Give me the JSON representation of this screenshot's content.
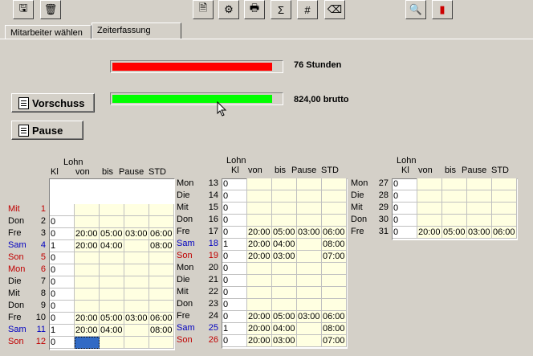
{
  "toolbar": [
    {
      "name": "save-icon",
      "glyph": "🖫"
    },
    {
      "name": "delete-icon",
      "glyph": "🗑"
    },
    {
      "name": "document-icon",
      "glyph": "🗎"
    },
    {
      "name": "calculate-icon",
      "glyph": "⚙"
    },
    {
      "name": "print-icon",
      "glyph": "🖶"
    },
    {
      "name": "sum-icon",
      "glyph": "Σ"
    },
    {
      "name": "number-document-icon",
      "glyph": "#"
    },
    {
      "name": "eraser-icon",
      "glyph": "⌫"
    },
    {
      "name": "search-icon",
      "glyph": "🔍"
    },
    {
      "name": "exit-icon",
      "glyph": "▮"
    }
  ],
  "tabs": {
    "employees": "Mitarbeiter wählen",
    "time": "Zeiterfassung"
  },
  "bars": {
    "hours": {
      "label": "76 Stunden",
      "fraction": 0.95,
      "color": "#ff0000"
    },
    "gross": {
      "label": "824,00 brutto",
      "fraction": 0.95,
      "color": "#00ff00"
    }
  },
  "buttons": {
    "advance": "Vorschuss",
    "pause": "Pause"
  },
  "headers": {
    "lohn": "Lohn",
    "kl": "Kl",
    "von": "von",
    "bis": "bis",
    "pause": "Pause",
    "std": "STD"
  },
  "colors": {
    "weekday": "#000000",
    "saturday": "#0000c0",
    "sunday_holiday": "#c00000"
  },
  "columns": [
    {
      "rows": [
        {
          "day": "Mit",
          "num": "1",
          "color": "red",
          "kl": "",
          "von": "",
          "bis": "",
          "pause": "",
          "std": ""
        },
        {
          "day": "Don",
          "num": "2",
          "color": "",
          "kl": "0",
          "von": "",
          "bis": "",
          "pause": "",
          "std": ""
        },
        {
          "day": "Fre",
          "num": "3",
          "color": "",
          "kl": "0",
          "von": "20:00",
          "bis": "05:00",
          "pause": "03:00",
          "std": "06:00"
        },
        {
          "day": "Sam",
          "num": "4",
          "color": "blue",
          "kl": "1",
          "von": "20:00",
          "bis": "04:00",
          "pause": "",
          "std": "08:00"
        },
        {
          "day": "Son",
          "num": "5",
          "color": "red",
          "kl": "0",
          "von": "",
          "bis": "",
          "pause": "",
          "std": ""
        },
        {
          "day": "Mon",
          "num": "6",
          "color": "red",
          "kl": "0",
          "von": "",
          "bis": "",
          "pause": "",
          "std": ""
        },
        {
          "day": "Die",
          "num": "7",
          "color": "",
          "kl": "0",
          "von": "",
          "bis": "",
          "pause": "",
          "std": ""
        },
        {
          "day": "Mit",
          "num": "8",
          "color": "",
          "kl": "0",
          "von": "",
          "bis": "",
          "pause": "",
          "std": ""
        },
        {
          "day": "Don",
          "num": "9",
          "color": "",
          "kl": "0",
          "von": "",
          "bis": "",
          "pause": "",
          "std": ""
        },
        {
          "day": "Fre",
          "num": "10",
          "color": "",
          "kl": "0",
          "von": "20:00",
          "bis": "05:00",
          "pause": "03:00",
          "std": "06:00"
        },
        {
          "day": "Sam",
          "num": "11",
          "color": "blue",
          "kl": "1",
          "von": "20:00",
          "bis": "04:00",
          "pause": "",
          "std": "08:00"
        },
        {
          "day": "Son",
          "num": "12",
          "color": "red",
          "kl": "0",
          "von": "",
          "bis": "",
          "pause": "",
          "std": "",
          "selected": true
        }
      ]
    },
    {
      "rows": [
        {
          "day": "Mon",
          "num": "13",
          "color": "",
          "kl": "0",
          "von": "",
          "bis": "",
          "pause": "",
          "std": ""
        },
        {
          "day": "Die",
          "num": "14",
          "color": "",
          "kl": "0",
          "von": "",
          "bis": "",
          "pause": "",
          "std": ""
        },
        {
          "day": "Mit",
          "num": "15",
          "color": "",
          "kl": "0",
          "von": "",
          "bis": "",
          "pause": "",
          "std": ""
        },
        {
          "day": "Don",
          "num": "16",
          "color": "",
          "kl": "0",
          "von": "",
          "bis": "",
          "pause": "",
          "std": ""
        },
        {
          "day": "Fre",
          "num": "17",
          "color": "",
          "kl": "0",
          "von": "20:00",
          "bis": "05:00",
          "pause": "03:00",
          "std": "06:00"
        },
        {
          "day": "Sam",
          "num": "18",
          "color": "blue",
          "kl": "1",
          "von": "20:00",
          "bis": "04:00",
          "pause": "",
          "std": "08:00"
        },
        {
          "day": "Son",
          "num": "19",
          "color": "red",
          "kl": "0",
          "von": "20:00",
          "bis": "03:00",
          "pause": "",
          "std": "07:00"
        },
        {
          "day": "Mon",
          "num": "20",
          "color": "",
          "kl": "0",
          "von": "",
          "bis": "",
          "pause": "",
          "std": ""
        },
        {
          "day": "Die",
          "num": "21",
          "color": "",
          "kl": "0",
          "von": "",
          "bis": "",
          "pause": "",
          "std": ""
        },
        {
          "day": "Mit",
          "num": "22",
          "color": "",
          "kl": "0",
          "von": "",
          "bis": "",
          "pause": "",
          "std": ""
        },
        {
          "day": "Don",
          "num": "23",
          "color": "",
          "kl": "0",
          "von": "",
          "bis": "",
          "pause": "",
          "std": ""
        },
        {
          "day": "Fre",
          "num": "24",
          "color": "",
          "kl": "0",
          "von": "20:00",
          "bis": "05:00",
          "pause": "03:00",
          "std": "06:00"
        },
        {
          "day": "Sam",
          "num": "25",
          "color": "blue",
          "kl": "1",
          "von": "20:00",
          "bis": "04:00",
          "pause": "",
          "std": "08:00"
        },
        {
          "day": "Son",
          "num": "26",
          "color": "red",
          "kl": "0",
          "von": "20:00",
          "bis": "03:00",
          "pause": "",
          "std": "07:00"
        }
      ]
    },
    {
      "rows": [
        {
          "day": "Mon",
          "num": "27",
          "color": "",
          "kl": "0",
          "von": "",
          "bis": "",
          "pause": "",
          "std": ""
        },
        {
          "day": "Die",
          "num": "28",
          "color": "",
          "kl": "0",
          "von": "",
          "bis": "",
          "pause": "",
          "std": ""
        },
        {
          "day": "Mit",
          "num": "29",
          "color": "",
          "kl": "0",
          "von": "",
          "bis": "",
          "pause": "",
          "std": ""
        },
        {
          "day": "Don",
          "num": "30",
          "color": "",
          "kl": "0",
          "von": "",
          "bis": "",
          "pause": "",
          "std": ""
        },
        {
          "day": "Fre",
          "num": "31",
          "color": "",
          "kl": "0",
          "von": "20:00",
          "bis": "05:00",
          "pause": "03:00",
          "std": "06:00"
        }
      ]
    }
  ]
}
